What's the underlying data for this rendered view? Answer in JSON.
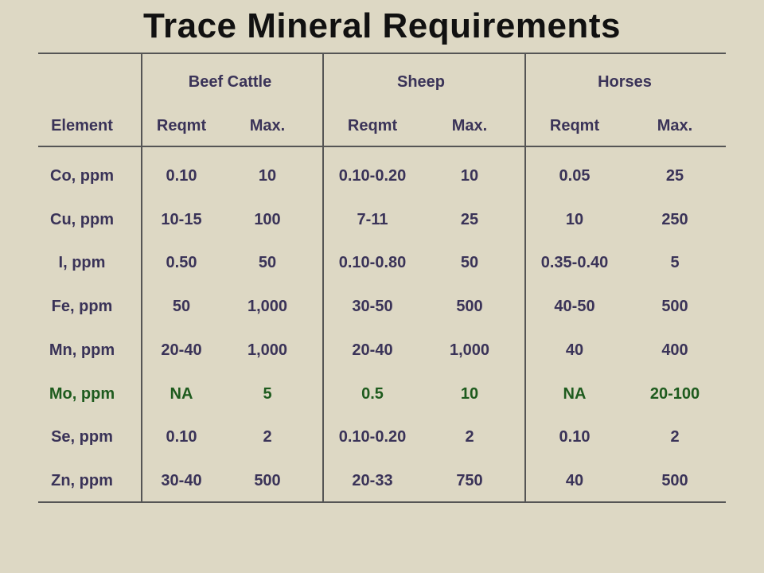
{
  "title": "Trace Mineral Requirements",
  "groups": [
    "Beef Cattle",
    "Sheep",
    "Horses"
  ],
  "columns": [
    "Element",
    "Reqmt",
    "Max.",
    "Reqmt",
    "Max.",
    "Reqmt",
    "Max."
  ],
  "rows": [
    [
      "Co, ppm",
      "0.10",
      "10",
      "0.10-0.20",
      "10",
      "0.05",
      "25"
    ],
    [
      "Cu, ppm",
      "10-15",
      "100",
      "7-11",
      "25",
      "10",
      "250"
    ],
    [
      "I, ppm",
      "0.50",
      "50",
      "0.10-0.80",
      "50",
      "0.35-0.40",
      "5"
    ],
    [
      "Fe, ppm",
      "50",
      "1,000",
      "30-50",
      "500",
      "40-50",
      "500"
    ],
    [
      "Mn, ppm",
      "20-40",
      "1,000",
      "20-40",
      "1,000",
      "40",
      "400"
    ],
    [
      "Mo, ppm",
      "NA",
      "5",
      "0.5",
      "10",
      "NA",
      "20-100"
    ],
    [
      "Se, ppm",
      "0.10",
      "2",
      "0.10-0.20",
      "2",
      "0.10",
      "2"
    ],
    [
      "Zn, ppm",
      "30-40",
      "500",
      "20-33",
      "750",
      "40",
      "500"
    ]
  ],
  "highlight_row": 5,
  "colors": {
    "text": "#3a3358",
    "highlight": "#1e5b1e",
    "background": "#ddd8c4"
  }
}
